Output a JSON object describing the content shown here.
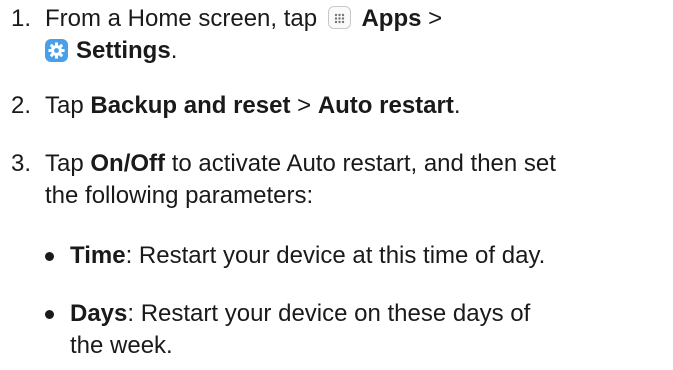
{
  "steps": [
    {
      "num": "1.",
      "t1": "From a Home screen, tap",
      "apps": "Apps",
      "gt": ">",
      "settings": "Settings",
      "end": "."
    },
    {
      "num": "2.",
      "t1": "Tap",
      "b1": "Backup and reset",
      "gt": ">",
      "b2": "Auto restart",
      "end": "."
    },
    {
      "num": "3.",
      "t1": "Tap",
      "b1": "On/Off",
      "t2": "to activate Auto restart, and then set",
      "t3": "the following parameters:"
    }
  ],
  "bullets": [
    {
      "label": "Time",
      "text": ": Restart your device at this time of day."
    },
    {
      "label": "Days",
      "text": ": Restart your device on these days of",
      "text2": "the week."
    }
  ],
  "icons": {
    "apps": "apps-grid-icon",
    "settings": "gear-icon",
    "settings_color": "#4aa0e8"
  }
}
